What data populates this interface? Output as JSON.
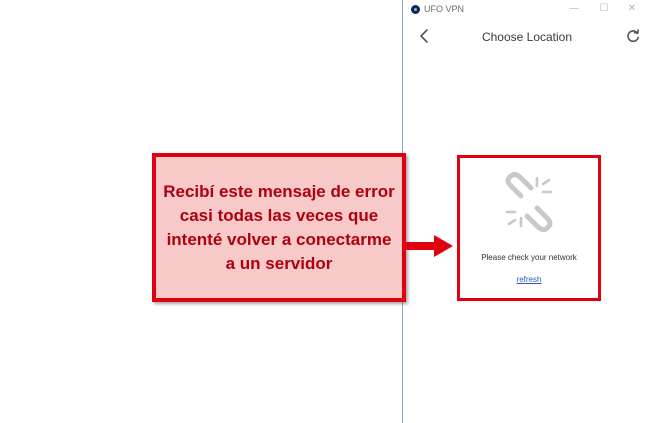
{
  "app": {
    "title": "UFO VPN",
    "minimize": "—",
    "maximize": "☐",
    "close": "✕"
  },
  "nav": {
    "title": "Choose Location",
    "back_icon": "chevron-left-icon",
    "refresh_icon": "refresh-icon"
  },
  "error": {
    "icon": "broken-link-icon",
    "message": "Please check your network",
    "refresh_label": "refresh"
  },
  "annotation": {
    "text": "Recibí este mensaje de error casi todas las veces que intenté volver a conectarme a un servidor"
  },
  "colors": {
    "highlight_red": "#e0000f",
    "callout_fill": "#f7c9c9",
    "callout_text": "#b0000f",
    "link_blue": "#2b5dbb",
    "window_border": "#8fa7c2"
  }
}
